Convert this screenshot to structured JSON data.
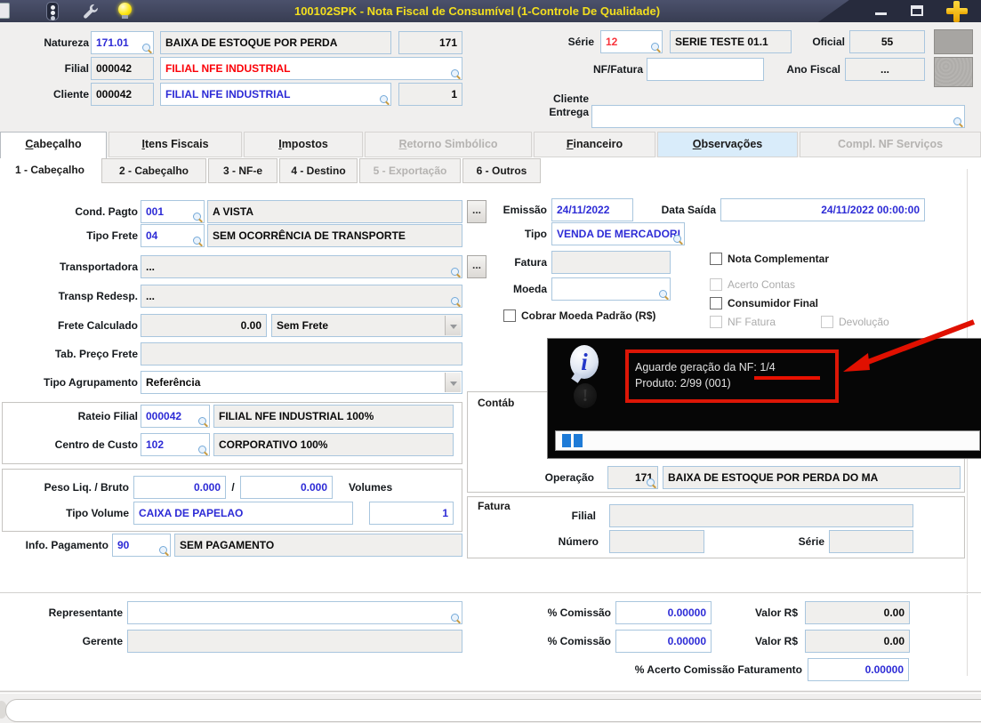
{
  "colors": {
    "titlebar_bg": "#3f4459",
    "title_text": "#f3df1e",
    "value_blue": "#2d2bd6",
    "serie_red": "#f8333b",
    "filial_red": "#fb0007",
    "annotation_red": "#dc1606",
    "progress_blue": "#1e7bd7",
    "tab_highlight": "#d9ecfa",
    "field_border": "#a9c6de",
    "readonly_bg": "#f0efed"
  },
  "title_bar": {
    "title": "100102SPK - Nota Fiscal de Consumível (1-Controle De Qualidade)",
    "icons": [
      "document-icon",
      "traffic-light-icon",
      "wrench-icon",
      "lightbulb-icon"
    ],
    "controls": [
      "minimize",
      "maximize",
      "add"
    ]
  },
  "header": {
    "natureza": {
      "label": "Natureza",
      "code": "171.01",
      "desc": "BAIXA DE ESTOQUE POR PERDA",
      "extra": "171"
    },
    "filial": {
      "label": "Filial",
      "code": "000042",
      "desc": "FILIAL NFE INDUSTRIAL"
    },
    "cliente": {
      "label": "Cliente",
      "code": "000042",
      "desc": "FILIAL NFE INDUSTRIAL",
      "loja": "1"
    },
    "serie": {
      "label": "Série",
      "code": "12",
      "desc": "SERIE TESTE 01.1"
    },
    "oficial": {
      "label": "Oficial",
      "value": "55"
    },
    "nf_fatura": {
      "label": "NF/Fatura",
      "value": ""
    },
    "ano_fiscal": {
      "label": "Ano Fiscal",
      "value": "..."
    },
    "cliente_entrega": {
      "label_line1": "Cliente",
      "label_line2": "Entrega",
      "value": ""
    }
  },
  "tabs": [
    {
      "label": "Cabeçalho",
      "state": "active"
    },
    {
      "label": "Itens Fiscais",
      "state": "normal"
    },
    {
      "label": "Impostos",
      "state": "normal"
    },
    {
      "label": "Retorno Simbólico",
      "state": "disabled"
    },
    {
      "label": "Financeiro",
      "state": "normal"
    },
    {
      "label": "Observações",
      "state": "highlight"
    },
    {
      "label": "Compl. NF Serviços",
      "state": "disabled"
    }
  ],
  "subtabs": [
    {
      "label": "1 - Cabeçalho",
      "state": "active"
    },
    {
      "label": "2 - Cabeçalho",
      "state": "normal"
    },
    {
      "label": "3 - NF-e",
      "state": "normal"
    },
    {
      "label": "4 - Destino",
      "state": "normal"
    },
    {
      "label": "5 - Exportação",
      "state": "disabled"
    },
    {
      "label": "6 - Outros",
      "state": "normal"
    }
  ],
  "form": {
    "ellipsis_button": "...",
    "cond_pagto": {
      "label": "Cond. Pagto",
      "code": "001",
      "desc": "A VISTA"
    },
    "tipo_frete": {
      "label": "Tipo Frete",
      "code": "04",
      "desc": "SEM OCORRÊNCIA DE TRANSPORTE"
    },
    "transportadora": {
      "label": "Transportadora",
      "value": "..."
    },
    "transp_redesp": {
      "label": "Transp Redesp.",
      "value": "..."
    },
    "frete_calculado": {
      "label": "Frete Calculado",
      "value": "0.00",
      "tipo": "Sem Frete"
    },
    "tab_preco_frete": {
      "label": "Tab. Preço Frete",
      "value": ""
    },
    "tipo_agrupamento": {
      "label": "Tipo Agrupamento",
      "value": "Referência"
    },
    "rateio_filial": {
      "label": "Rateio Filial",
      "code": "000042",
      "desc": "FILIAL NFE INDUSTRIAL 100%"
    },
    "centro_custo": {
      "label": "Centro de Custo",
      "code": "102",
      "desc": "CORPORATIVO 100%"
    },
    "peso": {
      "label": "Peso Liq. / Bruto",
      "liquido": "0.000",
      "separator": "/",
      "bruto": "0.000",
      "volumes_label": "Volumes"
    },
    "tipo_volume": {
      "label": "Tipo Volume",
      "value": "CAIXA DE PAPELAO",
      "volumes": "1"
    },
    "info_pagamento": {
      "label": "Info. Pagamento",
      "code": "90",
      "desc": "SEM PAGAMENTO"
    },
    "emissao": {
      "label": "Emissão",
      "value": "24/11/2022"
    },
    "data_saida": {
      "label": "Data Saída",
      "value": "24/11/2022 00:00:00"
    },
    "tipo": {
      "label": "Tipo",
      "value": "VENDA DE MERCADORI"
    },
    "fatura": {
      "label": "Fatura",
      "value": ""
    },
    "moeda": {
      "label": "Moeda",
      "value": ""
    },
    "checkboxes": {
      "cobrar_moeda": {
        "label": "Cobrar Moeda Padrão (R$)",
        "checked": false,
        "enabled": true
      },
      "nota_complementar": {
        "label": "Nota Complementar",
        "checked": false,
        "enabled": true
      },
      "acerto_contas": {
        "label": "Acerto Contas",
        "checked": false,
        "enabled": false
      },
      "consumidor_final": {
        "label": "Consumidor Final",
        "checked": false,
        "enabled": true
      },
      "nf_fatura": {
        "label": "NF Fatura",
        "checked": false,
        "enabled": false
      },
      "devolucao": {
        "label": "Devolução",
        "checked": false,
        "enabled": false
      }
    },
    "contabil_group": {
      "label": "Contáb"
    },
    "operacao": {
      "label": "Operação",
      "code": "171",
      "desc": "BAIXA DE ESTOQUE POR PERDA DO MA"
    },
    "fatura_group": {
      "label": "Fatura",
      "filial_label": "Filial",
      "filial": "",
      "numero_label": "Número",
      "numero": "",
      "serie_label": "Série",
      "serie": ""
    },
    "representante": {
      "label": "Representante",
      "value": ""
    },
    "gerente": {
      "label": "Gerente",
      "value": ""
    },
    "comissao1": {
      "label": "% Comissão",
      "value": "0.00000",
      "valor_label": "Valor R$",
      "valor": "0.00"
    },
    "comissao2": {
      "label": "% Comissão",
      "value": "0.00000",
      "valor_label": "Valor R$",
      "valor": "0.00"
    },
    "acerto_comissao": {
      "label": "% Acerto Comissão Faturamento",
      "value": "0.00000"
    }
  },
  "popup": {
    "line1": "Aguarde geração da NF: 1/4",
    "line2": "Produto: 2/99 (001)",
    "progress_blocks": 2
  }
}
